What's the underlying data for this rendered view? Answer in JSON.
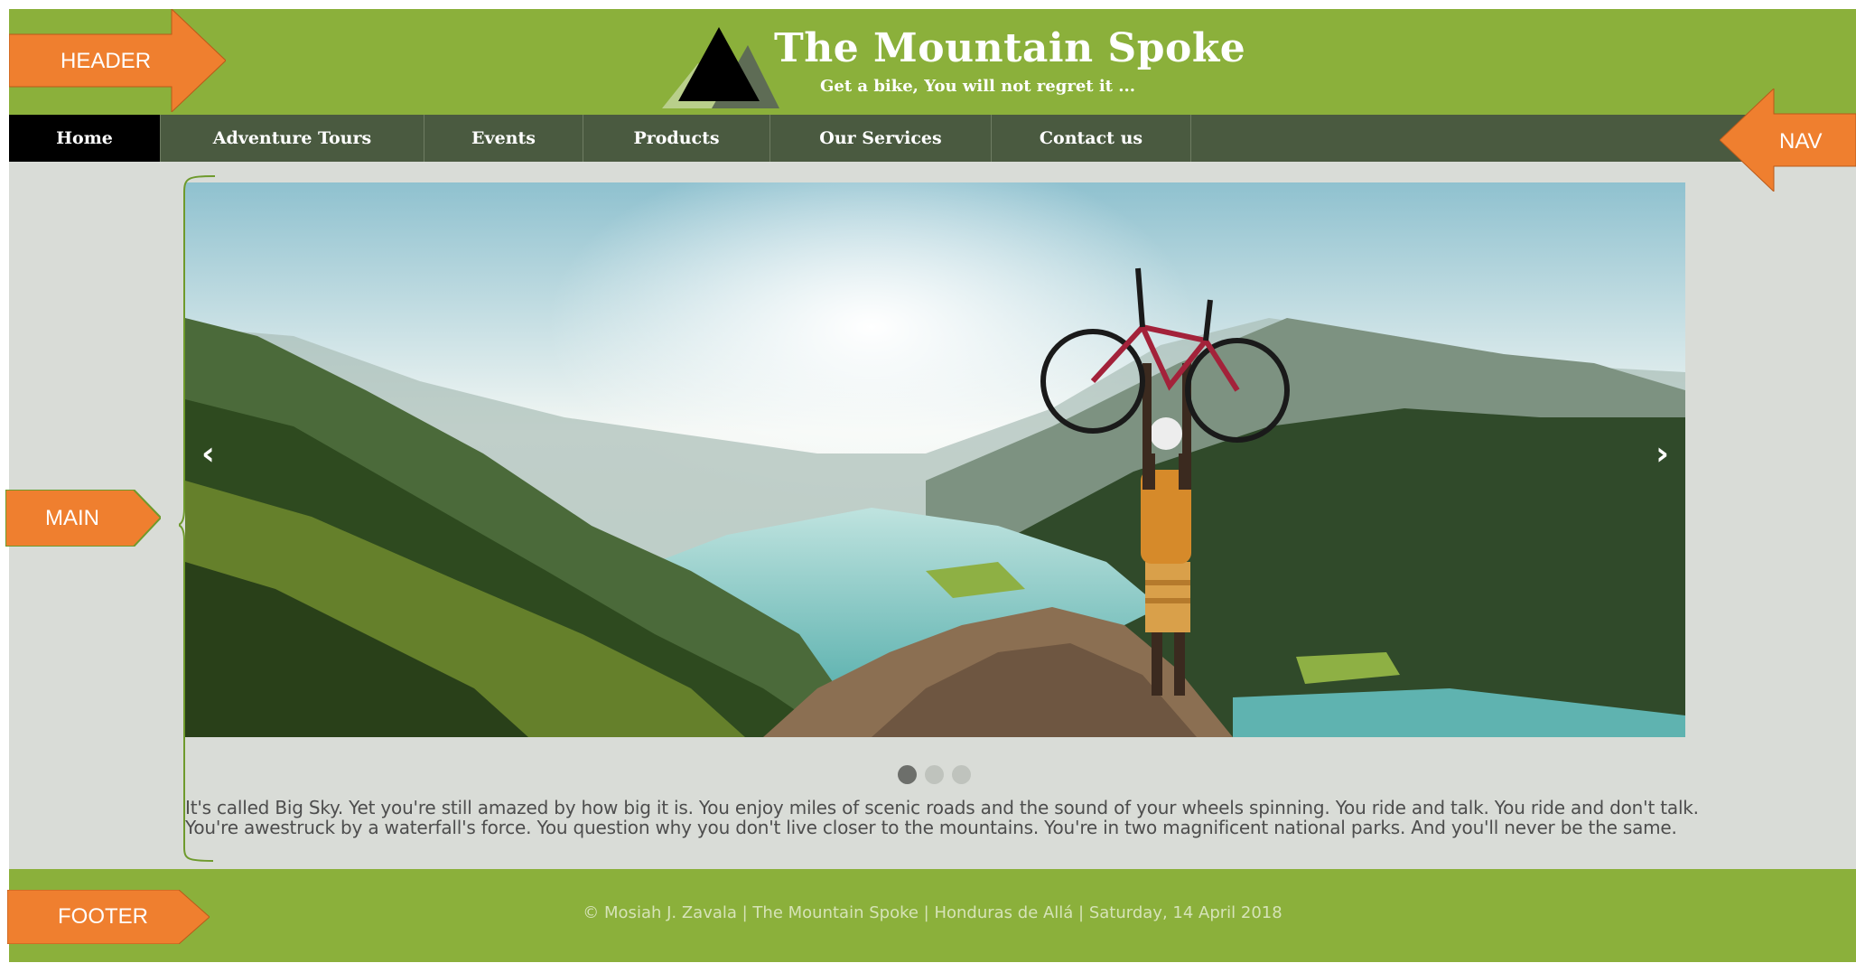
{
  "header": {
    "title": "The Mountain Spoke",
    "tagline": "Get a bike, You will not regret it ..."
  },
  "nav": {
    "items": [
      {
        "label": "Home",
        "active": true
      },
      {
        "label": "Adventure Tours"
      },
      {
        "label": "Events"
      },
      {
        "label": "Products"
      },
      {
        "label": "Our Services"
      },
      {
        "label": "Contact us"
      }
    ]
  },
  "slider": {
    "prev_icon": "‹",
    "next_icon": "›",
    "dot_count": 3,
    "active_dot": 1,
    "image_icon": "mountain-biker-hero-image"
  },
  "main": {
    "paragraph": "It's called Big Sky. Yet you're still amazed by how big it is. You enjoy miles of scenic roads and the sound of your wheels spinning. You ride and talk. You ride and don't talk. You're awestruck by a waterfall's force. You question why you don't live closer to the mountains. You're in two magnificent national parks. And you'll never be the same."
  },
  "footer": {
    "text": "© Mosiah J. Zavala | The Mountain Spoke | Honduras de Allá | Saturday, 14 April 2018"
  },
  "annotations": {
    "header": "HEADER",
    "nav": "NAV",
    "main": "MAIN",
    "footer": "FOOTER"
  },
  "colors": {
    "brand_green": "#8bb03b",
    "nav_dark": "#4a5a40",
    "annotation_orange": "#ef7f2f"
  }
}
